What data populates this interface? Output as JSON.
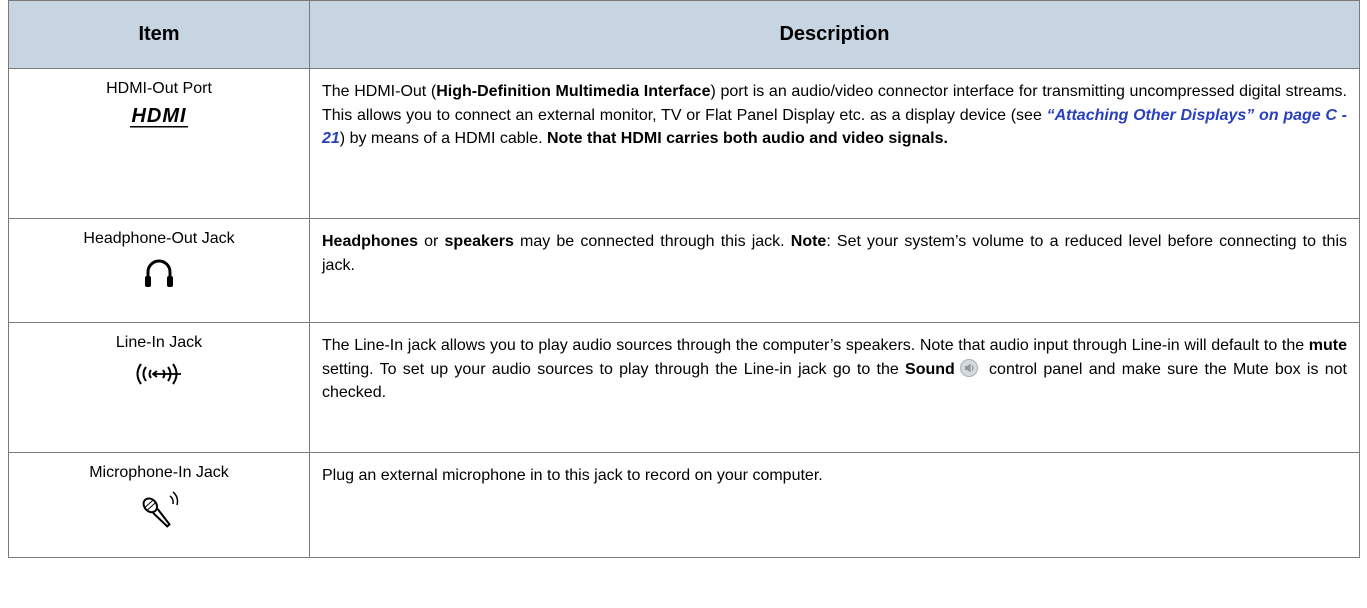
{
  "table": {
    "header": {
      "item": "Item",
      "description": "Description"
    },
    "rows": [
      {
        "item": "HDMI-Out Port",
        "icon": "hdmi-logo-icon",
        "logo_text": "HDMI",
        "desc": {
          "t1": "The HDMI-Out (",
          "b1": "High-Definition Multimedia Interface",
          "t2": ") port is an audio/video connector interface for transmitting uncompressed digital streams. This allows you to connect an external monitor, TV or Flat Panel Display etc. as a display device (see ",
          "link": "“Attaching Other Displays” on page C - 21",
          "t3": ") by means of a HDMI cable. ",
          "b2": "Note that HDMI carries both audio and video signals."
        }
      },
      {
        "item": "Headphone-Out Jack",
        "icon": "headphones-icon",
        "desc": {
          "b1": "Headphones",
          "t1": " or ",
          "b2": "speakers",
          "t2": " may be connected through this jack. ",
          "b3": "Note",
          "t3": ": Set your system’s volume to a reduced level before connecting to this jack."
        }
      },
      {
        "item": "Line-In Jack",
        "icon": "line-in-icon",
        "desc": {
          "t1": "The Line-In jack allows you to play audio sources through the computer’s speakers. Note that audio input through Line-in will default to the ",
          "b1": "mute",
          "t2": " setting. To set up your audio sources to play through the Line-in jack go to the ",
          "b2": "Sound",
          "sound_icon": "speaker-icon",
          "t3": " control panel and make sure the Mute box is not checked."
        }
      },
      {
        "item": "Microphone-In Jack",
        "icon": "microphone-icon",
        "desc": {
          "t1": "Plug an external microphone in to this jack to record on your computer."
        }
      }
    ]
  }
}
